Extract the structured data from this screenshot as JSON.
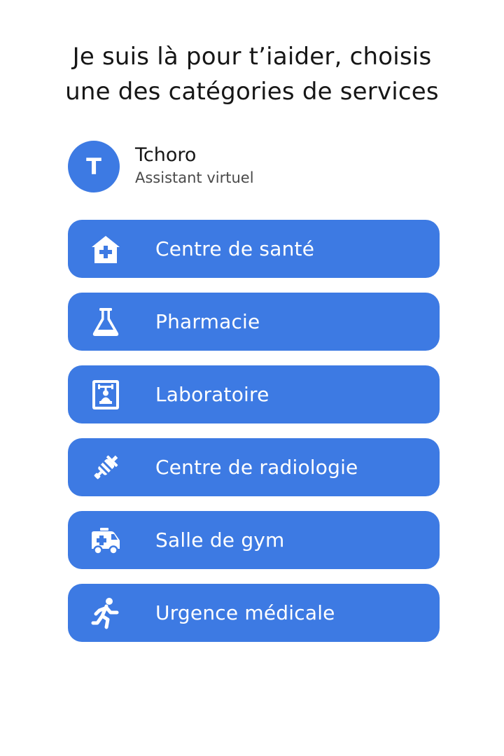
{
  "heading": {
    "line1": "Je suis là pour t’iaider, choisis",
    "line2": "une des catégories de services"
  },
  "assistant": {
    "initial": "T",
    "name": "Tchoro",
    "role": "Assistant virtuel"
  },
  "colors": {
    "accent": "#3d7ae3",
    "text": "#161616",
    "subtext": "#4a4a4a",
    "background": "#ffffff"
  },
  "services": [
    {
      "label": "Centre de santé",
      "icon": "health-center-icon"
    },
    {
      "label": "Pharmacie",
      "icon": "flask-icon"
    },
    {
      "label": "Laboratoire",
      "icon": "lab-device-icon"
    },
    {
      "label": "Centre de radiologie",
      "icon": "syringe-icon"
    },
    {
      "label": "Salle de gym",
      "icon": "ambulance-icon"
    },
    {
      "label": "Urgence médicale",
      "icon": "running-person-icon"
    }
  ]
}
